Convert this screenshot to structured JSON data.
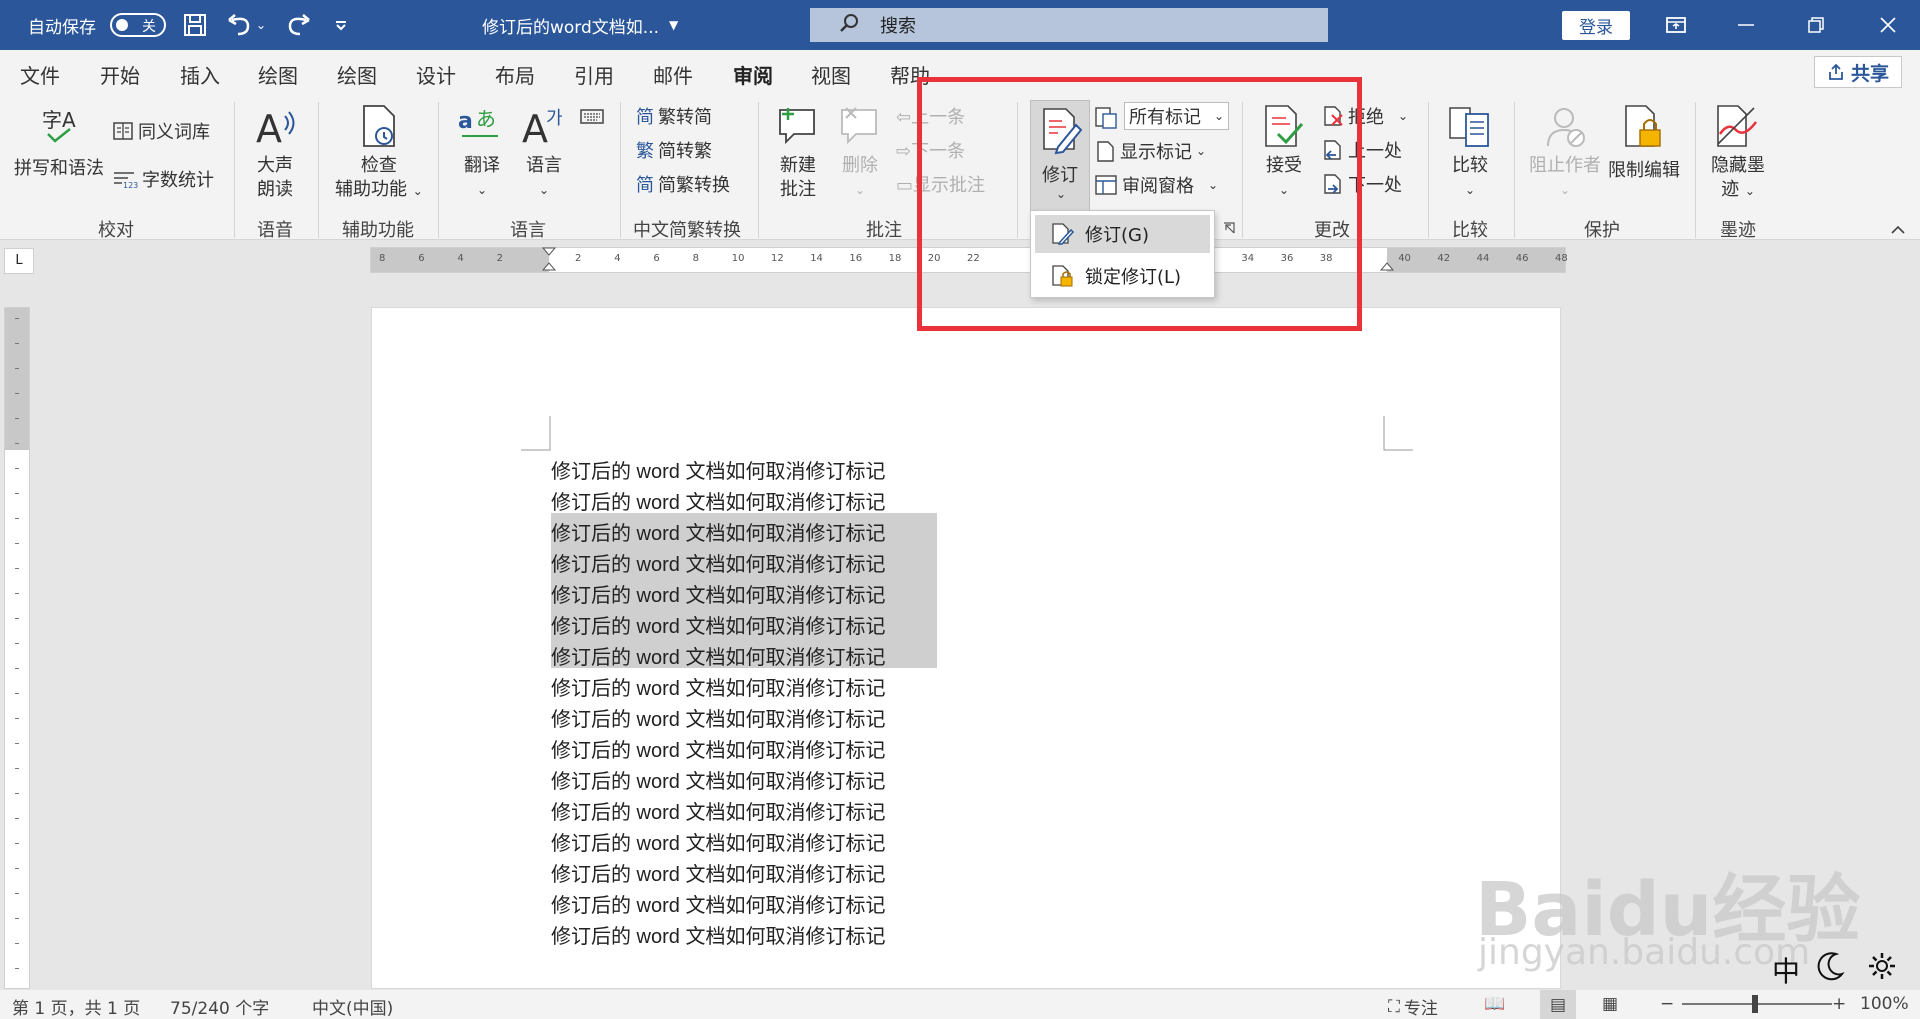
{
  "titlebar": {
    "autosave_label": "自动保存",
    "autosave_state": "关",
    "doc_title": "修订后的word文档如...",
    "search_placeholder": "搜索",
    "login_label": "登录"
  },
  "tabs": [
    "文件",
    "开始",
    "插入",
    "绘图",
    "绘图",
    "设计",
    "布局",
    "引用",
    "邮件",
    "审阅",
    "视图",
    "帮助"
  ],
  "active_tab": "审阅",
  "share_label": "共享",
  "ribbon": {
    "proofing": {
      "spelling": "拼写和语法",
      "thesaurus": "同义词库",
      "wordcount": "字数统计",
      "label": "校对",
      "spell_icon_text": "字A"
    },
    "speech": {
      "read_aloud_1": "大声",
      "read_aloud_2": "朗读",
      "label": "语音"
    },
    "accessibility": {
      "check_1": "检查",
      "check_2": "辅助功能",
      "label": "辅助功能"
    },
    "language": {
      "translate": "翻译",
      "language": "语言",
      "label": "语言"
    },
    "chinese": {
      "to_simplified": "繁转简",
      "to_traditional": "简转繁",
      "convert": "简繁转换",
      "label": "中文简繁转换",
      "icon_fan": "简",
      "icon_jian": "繁",
      "icon_conv": "简"
    },
    "comments": {
      "new_1": "新建",
      "new_2": "批注",
      "delete": "删除",
      "prev": "上一条",
      "next": "下一条",
      "show": "显示批注",
      "label": "批注"
    },
    "tracking": {
      "track": "修订",
      "markup_select": "所有标记",
      "show_markup": "显示标记",
      "reviewing_pane": "审阅窗格"
    },
    "changes": {
      "accept": "接受",
      "reject": "拒绝",
      "prev": "上一处",
      "next": "下一处",
      "label": "更改"
    },
    "compare": {
      "compare": "比较",
      "label": "比较"
    },
    "protect": {
      "block": "阻止作者",
      "restrict": "限制编辑",
      "label": "保护"
    },
    "ink": {
      "hide_1": "隐藏墨",
      "hide_2": "迹",
      "label": "墨迹"
    }
  },
  "dropdown": {
    "item1": "修订(G)",
    "item2": "锁定修订(L)"
  },
  "ruler_labels": [
    "8",
    "6",
    "4",
    "2",
    "",
    "2",
    "4",
    "6",
    "8",
    "10",
    "12",
    "14",
    "16",
    "18",
    "20",
    "22",
    "",
    "",
    "",
    "",
    "",
    "32",
    "34",
    "36",
    "38",
    "",
    "40",
    "42",
    "44",
    "46",
    "48"
  ],
  "document": {
    "line_text": "修订后的 word 文档如何取消修订标记",
    "line_count": 16,
    "selected_lines": [
      3,
      4,
      5,
      6,
      7
    ]
  },
  "statusbar": {
    "page": "第 1 页，共 1 页",
    "words": "75/240 个字",
    "lang": "中文(中国)",
    "focus": "专注",
    "zoom": "100%",
    "ime": "中"
  },
  "watermark": {
    "brand": "Baidu经验",
    "url": "jingyan.baidu.com"
  },
  "colors": {
    "titlebar": "#2b579a",
    "highlight_box": "#e8333a",
    "selection": "#cfcfcf"
  }
}
